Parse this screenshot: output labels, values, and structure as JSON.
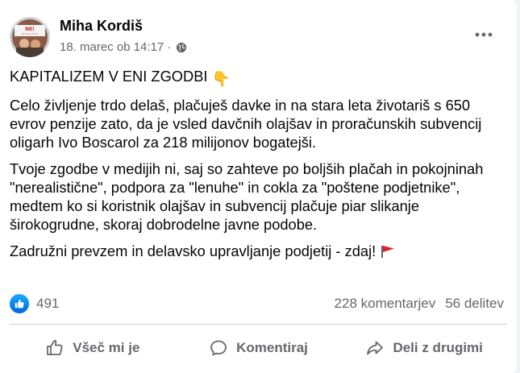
{
  "post": {
    "author": "Miha Kordiš",
    "timestamp": "18. marec ob 14:17",
    "separator": "·",
    "privacy_icon": "globe-icon",
    "more_icon": "more-options-icon",
    "paragraphs": [
      "KAPITALIZEM V ENI ZGODBI",
      "Celo življenje trdo delaš, plačuješ davke in na stara leta životariš s 650 evrov penzije zato, da je vsled davčnih olajšav in proračunskih subvencij oligarh Ivo Boscarol za 218 milijonov bogatejši.",
      "Tvoje zgodbe v medijih ni, saj so zahteve po boljših plačah in pokojninah \"nerealistične\", podpora za \"lenuhe\" in cokla za \"poštene podjetnike\", medtem ko si koristnik olajšav in subvencij plačuje piar slikanje širokogrudne, skoraj dobrodelne javne podobe.",
      "Zadružni prevzem in delavsko upravljanje podjetij - zdaj!"
    ],
    "emoji_after_title": "👇",
    "emoji_after_last": "🚩"
  },
  "stats": {
    "like_count": "491",
    "comments": "228 komentarjev",
    "shares": "56 delitev"
  },
  "actions": {
    "like": "Všeč mi je",
    "comment": "Komentiraj",
    "share": "Deli z drugimi"
  },
  "colors": {
    "facebook_blue": "#0866ff",
    "secondary_text": "#65676b",
    "divider": "#ced0d4",
    "flag_red": "#e02424"
  }
}
